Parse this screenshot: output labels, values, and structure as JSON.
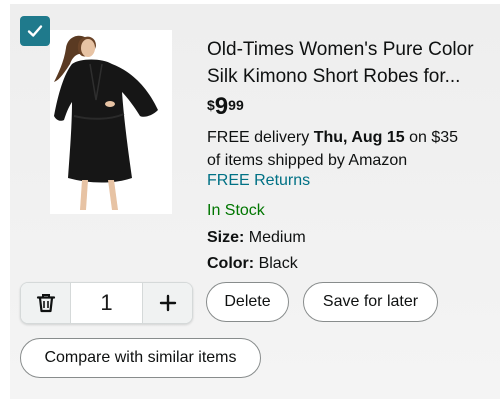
{
  "product": {
    "title_line1": "Old-Times Women's Pure Color",
    "title_line2": "Silk Kimono Short Robes for...",
    "price": {
      "symbol": "$",
      "whole": "9",
      "fraction": "99"
    },
    "delivery": {
      "prefix": "FREE delivery ",
      "date": "Thu, Aug 15",
      "suffix": " on $35",
      "line2": "of items shipped by Amazon"
    },
    "returns": "FREE Returns",
    "stock": "In Stock",
    "size_label": "Size:",
    "size_value": "Medium",
    "color_label": "Color:",
    "color_value": "Black",
    "selected": true
  },
  "quantity": {
    "value": "1"
  },
  "actions": {
    "delete": "Delete",
    "save_for_later": "Save for later",
    "compare": "Compare with similar items"
  },
  "colors": {
    "checkbox": "#1f7a8c",
    "link": "#007185",
    "in_stock": "#007600"
  },
  "icons": {
    "checkbox": "check-icon",
    "decrement": "trash-icon",
    "increment": "plus-icon"
  }
}
